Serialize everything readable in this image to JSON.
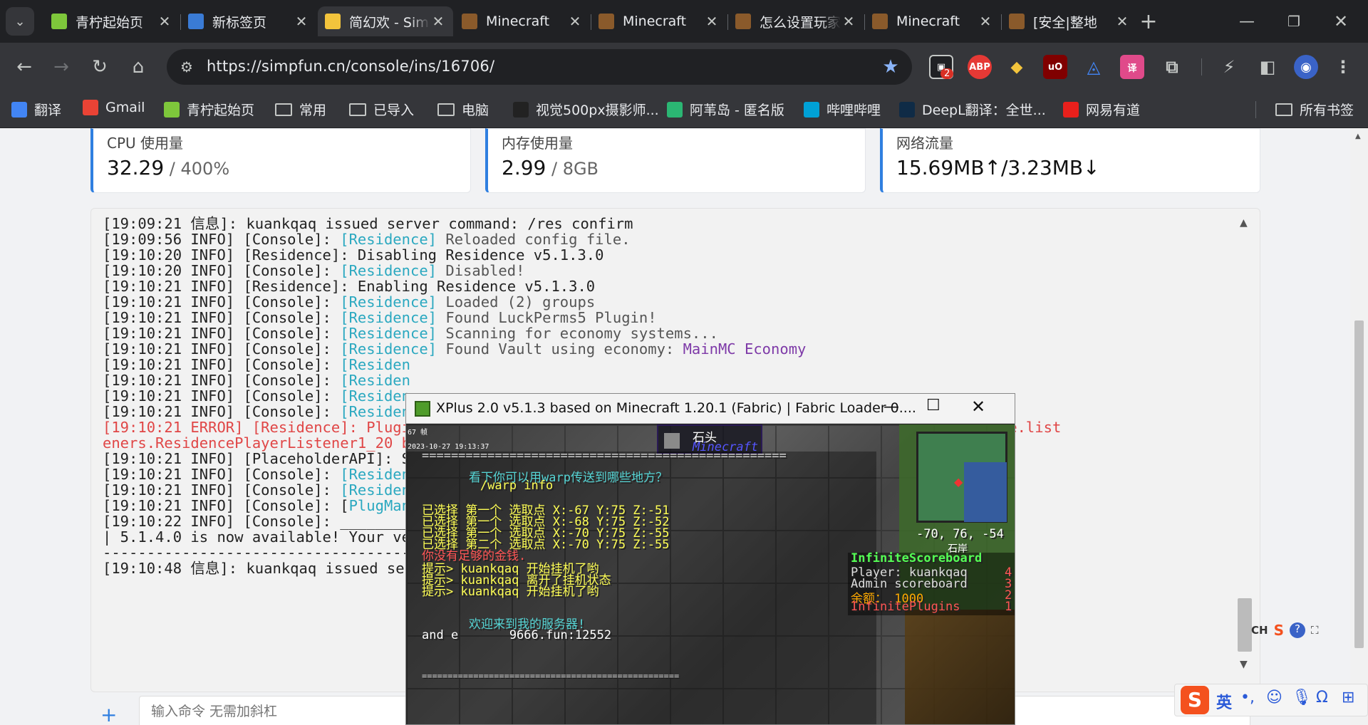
{
  "tabs": [
    {
      "title": "青柠起始页",
      "active": false,
      "icon_color": "#7ec73b"
    },
    {
      "title": "新标签页",
      "active": false,
      "icon_color": "#3a7bd5"
    },
    {
      "title": "简幻欢 - SimpFun",
      "active": true,
      "icon_color": "#f3c43c"
    },
    {
      "title": "Minecraft",
      "active": false,
      "icon_color": "#8a5a2b"
    },
    {
      "title": "Minecraft",
      "active": false,
      "icon_color": "#8a5a2b"
    },
    {
      "title": "怎么设置玩家",
      "active": false,
      "icon_color": "#8a5a2b"
    },
    {
      "title": "Minecraft",
      "active": false,
      "icon_color": "#8a5a2b"
    },
    {
      "title": "[安全|整地",
      "active": false,
      "icon_color": "#8a5a2b"
    }
  ],
  "toolbar": {
    "url": "https://simpfun.cn/console/ins/16706/",
    "ext_badge": "2"
  },
  "bookmarks": [
    {
      "label": "翻译",
      "icon": "translate-icon"
    },
    {
      "label": "Gmail",
      "icon": "gmail-icon"
    },
    {
      "label": "青柠起始页",
      "icon": "lime-icon"
    },
    {
      "label": "常用",
      "icon": "folder-icon"
    },
    {
      "label": "已导入",
      "icon": "folder-icon"
    },
    {
      "label": "电脑",
      "icon": "folder-icon"
    },
    {
      "label": "视觉500px摄影师...",
      "icon": "500px-icon"
    },
    {
      "label": "阿苇岛 - 匿名版",
      "icon": "island-icon"
    },
    {
      "label": "哔哩哔哩",
      "icon": "bilibili-icon"
    },
    {
      "label": "DeepL翻译：全世...",
      "icon": "deepl-icon"
    },
    {
      "label": "网易有道",
      "icon": "youdao-icon"
    }
  ],
  "all_bookmarks": "所有书签",
  "stats": [
    {
      "label": "CPU 使用量",
      "value": "32.29",
      "sub": " / 400%"
    },
    {
      "label": "内存使用量",
      "value": "2.99",
      "sub": " / 8GB"
    },
    {
      "label": "网络流量",
      "value": "15.69MB↑/3.23MB↓",
      "sub": ""
    }
  ],
  "console_lines": [
    [
      {
        "t": "[19:09:21 信息]: kuankqaq issued server command: /res confirm",
        "c": ""
      }
    ],
    [
      {
        "t": "[19:09:56 INFO] [Console]: ",
        "c": ""
      },
      {
        "t": "[Residence]",
        "c": "cy"
      },
      {
        "t": " Reloaded config file.",
        "c": "gr"
      }
    ],
    [
      {
        "t": "[19:10:20 INFO] [Residence]: Disabling Residence v5.1.3.0",
        "c": ""
      }
    ],
    [
      {
        "t": "[19:10:20 INFO] [Console]: ",
        "c": ""
      },
      {
        "t": "[Residence]",
        "c": "cy"
      },
      {
        "t": " Disabled!",
        "c": "gr"
      }
    ],
    [
      {
        "t": "[19:10:21 INFO] [Residence]: Enabling Residence v5.1.3.0",
        "c": ""
      }
    ],
    [
      {
        "t": "[19:10:21 INFO] [Console]: ",
        "c": ""
      },
      {
        "t": "[Residence]",
        "c": "cy"
      },
      {
        "t": " Loaded (2) groups",
        "c": "gr"
      }
    ],
    [
      {
        "t": "[19:10:21 INFO] [Console]: ",
        "c": ""
      },
      {
        "t": "[Residence]",
        "c": "cy"
      },
      {
        "t": " Found LuckPerms5 Plugin!",
        "c": "gr"
      }
    ],
    [
      {
        "t": "[19:10:21 INFO] [Console]: ",
        "c": ""
      },
      {
        "t": "[Residence]",
        "c": "cy"
      },
      {
        "t": " Scanning for economy systems...",
        "c": "gr"
      }
    ],
    [
      {
        "t": "[19:10:21 INFO] [Console]: ",
        "c": ""
      },
      {
        "t": "[Residence]",
        "c": "cy"
      },
      {
        "t": " Found Vault using economy: ",
        "c": "gr"
      },
      {
        "t": "MainMC Economy",
        "c": "pu"
      }
    ],
    [
      {
        "t": "[19:10:21 INFO] [Console]: ",
        "c": ""
      },
      {
        "t": "[Residen",
        "c": "cy"
      }
    ],
    [
      {
        "t": "[19:10:21 INFO] [Console]: ",
        "c": ""
      },
      {
        "t": "[Residen",
        "c": "cy"
      }
    ],
    [
      {
        "t": "[19:10:21 INFO] [Console]: ",
        "c": ""
      },
      {
        "t": "[Residen",
        "c": "cy"
      }
    ],
    [
      {
        "t": "[19:10:21 INFO] [Console]: ",
        "c": ""
      },
      {
        "t": "[Residen",
        "c": "cy"
      }
    ],
    [
      {
        "t": "[19:10:21 ERROR] [Residence]: Plugi",
        "c": "er"
      },
      {
        "t": "                                                 ",
        "c": ""
      },
      {
        "t": "von.bukkit.residence.list",
        "c": "er"
      }
    ],
    [
      {
        "t": "eners.ResidencePlayerListener1_20 b",
        "c": "er"
      }
    ],
    [
      {
        "t": "[19:10:21 INFO] [PlaceholderAPI]: S",
        "c": ""
      }
    ],
    [
      {
        "t": "[19:10:21 INFO] [Console]: ",
        "c": ""
      },
      {
        "t": "[Residen",
        "c": "cy"
      }
    ],
    [
      {
        "t": "[19:10:21 INFO] [Console]: ",
        "c": ""
      },
      {
        "t": "[Residen",
        "c": "cy"
      }
    ],
    [
      {
        "t": "[19:10:21 INFO] [Console]: [",
        "c": ""
      },
      {
        "t": "PlugMan",
        "c": "cy"
      }
    ],
    [
      {
        "t": "[19:10:22 INFO] [Console]: ________",
        "c": ""
      }
    ],
    [
      {
        "t": "| 5.1.4.0 is now available! Your ve",
        "c": ""
      }
    ],
    [
      {
        "t": "-----------------------------------",
        "c": ""
      }
    ],
    [
      {
        "t": "[19:10:48 信息]: kuankqaq issued se",
        "c": ""
      }
    ]
  ],
  "cmd_placeholder": "输入命令 无需加斜杠",
  "game": {
    "title": "XPlus 2.0 v5.1.3 based on Minecraft 1.20.1 (Fabric) | Fabric Loader 0....",
    "block_name": "石头",
    "block_mod": "Minecraft",
    "chat": [
      {
        "t": "看下你可以用warp传送到哪些地方？",
        "c": "#55d4d4"
      },
      {
        "t": "        /warp info",
        "c": "#ffff55"
      },
      {
        "t": "已选择 第一个 选取点 X:-67 Y:75 Z:-51",
        "c": "#ffff55"
      },
      {
        "t": "已选择 第一个 选取点 X:-68 Y:75 Z:-52",
        "c": "#ffff55"
      },
      {
        "t": "已选择 第一个 选取点 X:-70 Y:75 Z:-55",
        "c": "#ffff55"
      },
      {
        "t": "已选择 第二个 选取点 X:-70 Y:75 Z:-55",
        "c": "#ffff55"
      },
      {
        "t": "你没有足够的金钱.",
        "c": "#ff5555"
      },
      {
        "t": "提示> kuankqaq 开始挂机了哟",
        "c": "#ffff55"
      },
      {
        "t": "提示> kuankqaq 离开了挂机状态",
        "c": "#ffff55"
      },
      {
        "t": "提示> kuankqaq 开始挂机了哟",
        "c": "#ffff55"
      },
      {
        "t": "欢迎来到我的服务器!",
        "c": "#55d4d4"
      },
      {
        "t": "and e       9666.fun:12552",
        "c": "#ffffff"
      }
    ],
    "coords": "-70, 76, -54",
    "biome": "石岸",
    "scoreboard_title": "InfiniteScoreboard",
    "scoreboard": [
      {
        "l": "Player: kuankqaq",
        "r": "4"
      },
      {
        "l": "Admin scoreboard",
        "r": "3"
      },
      {
        "l": "余额： 1000",
        "r": "2"
      },
      {
        "l": "InfinitePlugins",
        "r": "1"
      }
    ],
    "hud_fps": "67 帧",
    "hud_date": "2023-10-27 19:13:37"
  },
  "ime": {
    "lang": "英",
    "ch": "CH"
  }
}
